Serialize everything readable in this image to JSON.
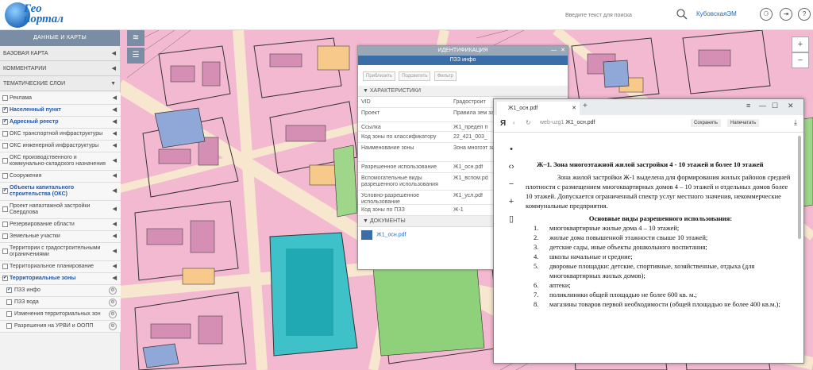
{
  "header": {
    "logo_line1": "Гео",
    "logo_line2": "портал",
    "search_placeholder": "Введите текст для поиска",
    "user": "КубовскаяЭМ",
    "btn1": "⚆",
    "btn2": "⇥",
    "btn3": "?"
  },
  "left_panel": {
    "title": "ДАННЫЕ И КАРТЫ",
    "sections": [
      "БАЗОВАЯ КАРТА",
      "КОММЕНТАРИИ",
      "ТЕМАТИЧЕСКИЕ СЛОИ"
    ],
    "layers": [
      {
        "label": "Реклама",
        "checked": false,
        "blue": false
      },
      {
        "label": "Населенный пункт",
        "checked": true,
        "blue": true
      },
      {
        "label": "Адресный реестр",
        "checked": true,
        "blue": true
      },
      {
        "label": "ОКС транспортной инфраструктуры",
        "checked": false,
        "blue": false
      },
      {
        "label": "ОКС инженерной инфраструктуры",
        "checked": false,
        "blue": false
      },
      {
        "label": "ОКС производственного и коммунально-складского назначения",
        "checked": false,
        "blue": false
      },
      {
        "label": "Сооружения",
        "checked": false,
        "blue": false
      },
      {
        "label": "Объекты капитального строительства (ОКС)",
        "checked": true,
        "blue": true
      },
      {
        "label": "Проект напазтажной застройки Свердлова",
        "checked": false,
        "blue": false
      },
      {
        "label": "Резервирование области",
        "checked": false,
        "blue": false
      },
      {
        "label": "Земельные участки",
        "checked": false,
        "blue": false
      },
      {
        "label": "Территории с градостроительными ограничениями",
        "checked": false,
        "blue": false
      },
      {
        "label": "Территориальное планирование",
        "checked": false,
        "blue": false
      },
      {
        "label": "Территориальные зоны",
        "checked": true,
        "blue": true
      }
    ],
    "sublayers": [
      {
        "label": "ПЗЗ инфо",
        "checked": true
      },
      {
        "label": "ПЗЗ вода",
        "checked": false
      },
      {
        "label": "Изменения территориальных зон",
        "checked": false
      },
      {
        "label": "Разрешения на УРВИ и ООПП",
        "checked": false
      }
    ]
  },
  "info_popup": {
    "header": "ИДЕНТИФИКАЦИЯ",
    "subheader": "ПЗЗ инфо",
    "buttons": [
      "Приблизить",
      "Подсветить",
      "Фильтр"
    ],
    "section_characteristics": "ХАРАКТЕРИСТИКИ",
    "rows": [
      {
        "k": "VID",
        "v": "Градостроит"
      },
      {
        "k": "Проект",
        "v": "Правила зем застройки г."
      },
      {
        "k": "Ссылка",
        "v": "Ж1_предел п"
      },
      {
        "k": "Код зоны по классификатору",
        "v": "22_421_003_"
      },
      {
        "k": "Наименование зоны",
        "v": "Зона многоэт застройки 4-"
      },
      {
        "k": "Разрешенное использование",
        "v": "Ж1_осн.pdf"
      },
      {
        "k": "Вспомогательные виды разрешенного использования",
        "v": "Ж1_вспом.pd"
      },
      {
        "k": "Условно-разрешенное использование",
        "v": "Ж1_усл.pdf"
      },
      {
        "k": "Код зоны по ПЗЗ",
        "v": "Ж-1"
      }
    ],
    "section_documents": "ДОКУМЕНТЫ",
    "doc": "Ж1_осн.pdf"
  },
  "pdf_window": {
    "tab_title": "Ж1_осн.pdf",
    "url_prefix": "web-uzg1",
    "url_file": "Ж1_осн.pdf",
    "save": "Сохранить",
    "print": "Напечатать",
    "heading": "Ж–1. Зона многоэтажной жилой застройки 4 - 10 этажей и более 10 этажей",
    "paragraph": "Зона жилой застройки Ж-1 выделена для формирования жилых районов средней плотности с размещением многоквартирных домов 4 – 10 этажей и отдельных домов более 10 этажей. Допускается ограниченный спектр услуг местного значения, некоммерческие коммунальные предприятия.",
    "subheading": "Основные виды разрешенного использования:",
    "items": [
      "многоквартирные жилые дома 4 – 10 этажей;",
      "жилые дома повышенной этажности свыше 10 этажей;",
      "детские сады, иные объекты дошкольного воспитания;",
      "школы начальные и средние;",
      "дворовые площадки: детские, спортивные, хозяйственные, отдыха (для многоквартирных жилых домов);",
      "аптеки;",
      "поликлиники общей площадью не более 600 кв. м.;",
      "магазины товаров первой необходимости (общей площадью не более 400 кв.м.);"
    ]
  },
  "map_controls": [
    "+",
    "−"
  ],
  "colors": {
    "accent": "#3b6ea8",
    "panel_title": "#7a8da4",
    "zone_pink": "#f5b5cf",
    "zone_road": "#fbe9d0"
  }
}
